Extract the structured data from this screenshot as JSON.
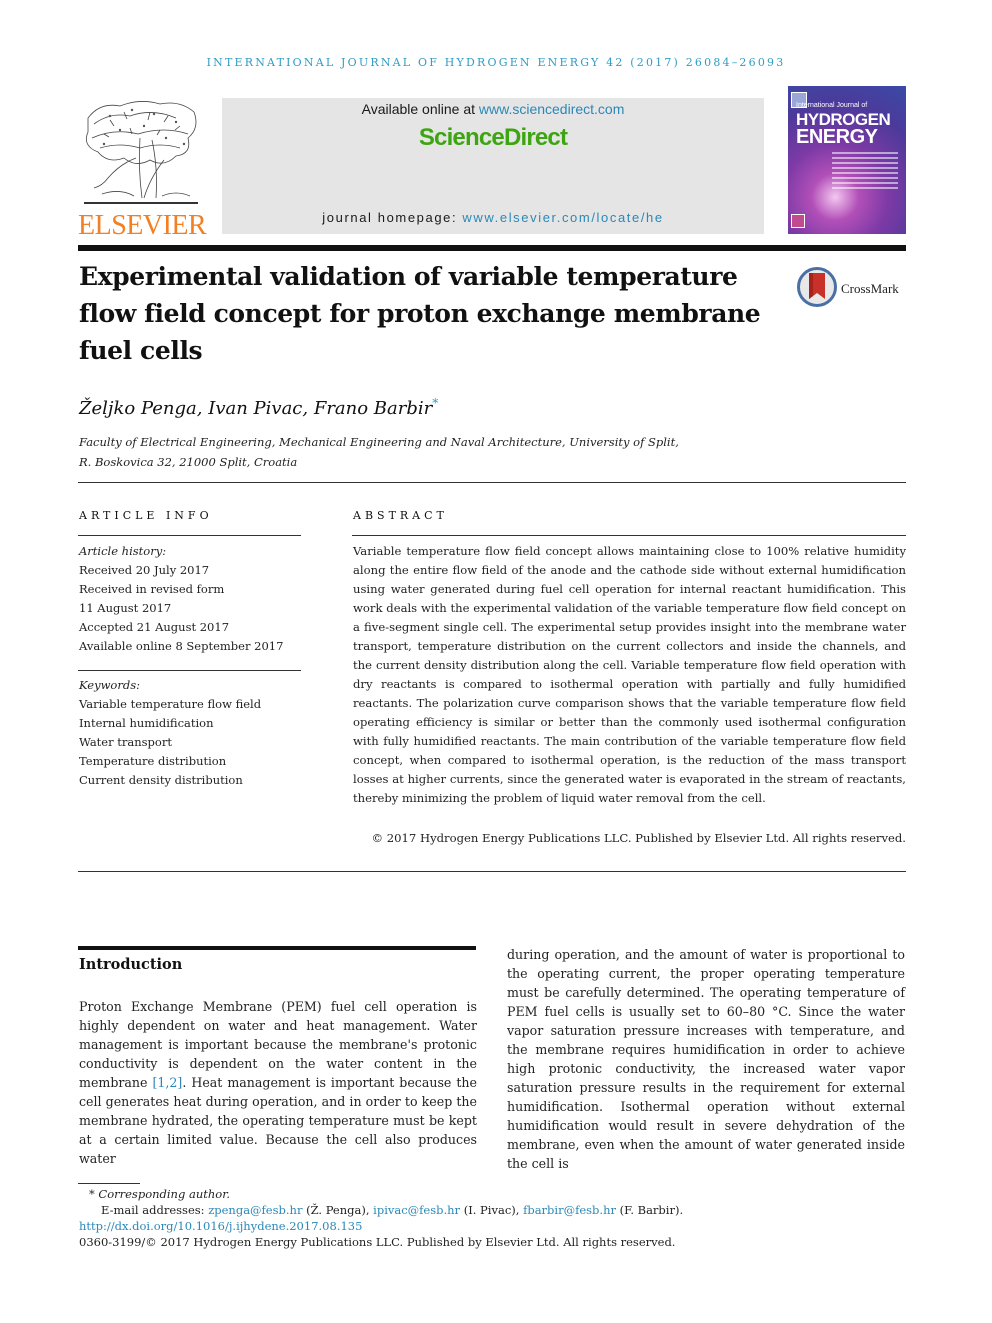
{
  "running_head": "INTERNATIONAL JOURNAL OF HYDROGEN ENERGY 42 (2017) 26084–26093",
  "publisher": {
    "logo_text": "ELSEVIER",
    "logo_icon": "elsevier-tree-icon"
  },
  "sciencedirect_box": {
    "available_prefix": "Available online at ",
    "available_link": "www.sciencedirect.com",
    "brand": "ScienceDirect",
    "homepage_prefix": "journal homepage: ",
    "homepage_link": "www.elsevier.com/locate/he"
  },
  "journal_cover": {
    "line1": "International Journal of",
    "line2": "HYDROGEN",
    "line3": "ENERGY"
  },
  "colors": {
    "link": "#2a88b8",
    "running_head": "#2f9dc4",
    "elsevier_orange": "#f47f20",
    "sciencedirect_green": "#3ea512"
  },
  "title": "Experimental validation of variable temperature flow field concept for proton exchange membrane fuel cells",
  "crossmark": {
    "label": "CrossMark",
    "icon": "crossmark-icon"
  },
  "authors": {
    "names": "Željko Penga, Ivan Pivac, Frano Barbir",
    "corresponding_marker": "*"
  },
  "affiliation": {
    "line1": "Faculty of Electrical Engineering, Mechanical Engineering and Naval Architecture, University of Split,",
    "line2": "R. Boskovica 32, 21000 Split, Croatia"
  },
  "article_info": {
    "heading": "ARTICLE INFO",
    "history_label": "Article history:",
    "history": [
      "Received 20 July 2017",
      "Received in revised form",
      "11 August 2017",
      "Accepted 21 August 2017",
      "Available online 8 September 2017"
    ],
    "keywords_label": "Keywords:",
    "keywords": [
      "Variable temperature flow field",
      "Internal humidification",
      "Water transport",
      "Temperature distribution",
      "Current density distribution"
    ]
  },
  "abstract": {
    "heading": "ABSTRACT",
    "text": "Variable temperature flow field concept allows maintaining close to 100% relative humidity along the entire flow field of the anode and the cathode side without external humidification using water generated during fuel cell operation for internal reactant humidification. This work deals with the experimental validation of the variable temperature flow field concept on a five-segment single cell. The experimental setup provides insight into the membrane water transport, temperature distribution on the current collectors and inside the channels, and the current density distribution along the cell. Variable temperature flow field operation with dry reactants is compared to isothermal operation with partially and fully humidified reactants. The polarization curve comparison shows that the variable temperature flow field operating efficiency is similar or better than the commonly used isothermal configuration with fully humidified reactants. The main contribution of the variable temperature flow field concept, when compared to isothermal operation, is the reduction of the mass transport losses at higher currents, since the generated water is evaporated in the stream of reactants, thereby minimizing the problem of liquid water removal from the cell.",
    "copyright": "© 2017 Hydrogen Energy Publications LLC. Published by Elsevier Ltd. All rights reserved."
  },
  "introduction": {
    "heading": "Introduction",
    "col1_before_cite": "Proton Exchange Membrane (PEM) fuel cell operation is highly dependent on water and heat management. Water management is important because the membrane's protonic conductivity is dependent on the water content in the membrane ",
    "col1_cite": "[1,2]",
    "col1_after_cite": ". Heat management is important because the cell generates heat during operation, and in order to keep the membrane hydrated, the operating temperature must be kept at a certain limited value. Because the cell also produces water",
    "col2": "during operation, and the amount of water is proportional to the operating current, the proper operating temperature must be carefully determined. The operating temperature of PEM fuel cells is usually set to 60–80 °C. Since the water vapor saturation pressure increases with temperature, and the membrane requires humidification in order to achieve high protonic conductivity, the increased water vapor saturation pressure results in the requirement for external humidification. Isothermal operation without external humidification would result in severe dehydration of the membrane, even when the amount of water generated inside the cell is"
  },
  "footnotes": {
    "corresponding_marker": "*",
    "corresponding_label": "Corresponding author.",
    "email_prefix": "E-mail addresses: ",
    "emails": [
      {
        "address": "zpenga@fesb.hr",
        "name": " (Ž. Penga), "
      },
      {
        "address": "ipivac@fesb.hr",
        "name": " (I. Pivac), "
      },
      {
        "address": "fbarbir@fesb.hr",
        "name": " (F. Barbir)."
      }
    ],
    "doi": "http://dx.doi.org/10.1016/j.ijhydene.2017.08.135",
    "issn_copyright": "0360-3199/© 2017 Hydrogen Energy Publications LLC. Published by Elsevier Ltd. All rights reserved."
  }
}
